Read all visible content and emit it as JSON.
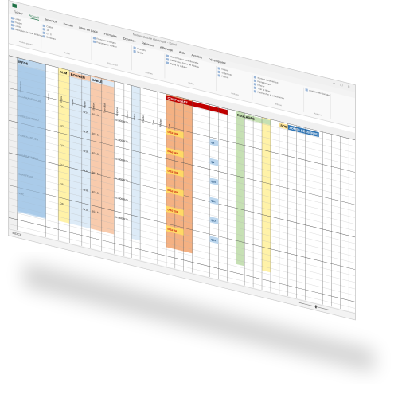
{
  "window": {
    "title": "Nomenclature électrique - Excel",
    "app_icon": "excel-icon",
    "tabs": [
      "Fichier",
      "Accueil",
      "Insertion",
      "Dessin",
      "Mise en page",
      "Formules",
      "Données",
      "Révision",
      "Affichage",
      "Aide",
      "Acrobat",
      "Développeur"
    ],
    "active_tab": "Accueil"
  },
  "ribbon": {
    "groups": [
      {
        "label": "Presse-papiers",
        "items": [
          "Coller",
          "Couper",
          "Copier",
          "Reproduire la mise en forme"
        ]
      },
      {
        "label": "Police",
        "items": [
          "Calibri",
          "11",
          "G I S",
          "Bordures"
        ]
      },
      {
        "label": "Alignement",
        "items": [
          "Renvoyer à la ligne",
          "Fusionner et centrer"
        ]
      },
      {
        "label": "Nombre",
        "items": [
          "Standard",
          "% 000"
        ]
      },
      {
        "label": "Styles",
        "items": [
          "Mise en forme conditionnelle",
          "Mettre sous forme de tableau",
          "Styles de cellules"
        ]
      },
      {
        "label": "Cellules",
        "items": [
          "Insérer",
          "Supprimer",
          "Format"
        ]
      },
      {
        "label": "Édition",
        "items": [
          "Somme automatique",
          "Remplissage",
          "Effacer",
          "Trier et filtrer",
          "Rechercher et sélectionner"
        ]
      },
      {
        "label": "Analyse",
        "items": [
          "Analyser les données"
        ]
      }
    ]
  },
  "sheet": {
    "sections": [
      {
        "label": "INFOS",
        "color": "#bdd7ee"
      },
      {
        "label": "ALIM",
        "color": "#fff2a8"
      },
      {
        "label": "BORNIER",
        "color": "#f8cbad"
      },
      {
        "label": "CABLE",
        "color": "#ddebf7"
      },
      {
        "label": "COMPOSANT",
        "color": "#f4b183"
      },
      {
        "label": "REGLAGES",
        "color": "#c6e0b4"
      },
      {
        "label": "SOS",
        "color": "#ffe699"
      },
      {
        "label": "ZONES DESSERTE",
        "color": "#2f75b5"
      }
    ],
    "column_headers": [
      "Désignation",
      "Divers",
      "Origine",
      "Départ",
      "Repère",
      "Section",
      "Type câble",
      "Longueur",
      "Appareil",
      "Calibre",
      "Courbe",
      "Type",
      "Réglage",
      "Zone"
    ],
    "rows": [
      {
        "designation": "ECLAIRAGE SALLE",
        "origine": "Q1",
        "repere": "W14",
        "section": "3G1.5",
        "cable": "U1000 R2V",
        "appareil": "DISJ 10A",
        "calibre": "Q8"
      },
      {
        "designation": "PRISES BUREAU",
        "origine": "Q2",
        "repere": "W15",
        "section": "3G2.5",
        "cable": "U1000 R2V",
        "appareil": "DISJ 16A",
        "calibre": "Q9"
      },
      {
        "designation": "PRISES ATELIER",
        "origine": "Q3",
        "repere": "W16",
        "section": "3G2.5",
        "cable": "U1000 R2V",
        "appareil": "DISJ 20A",
        "calibre": "Q10"
      },
      {
        "designation": "ECLAIRAGE EXT",
        "origine": "Q4",
        "repere": "W17",
        "section": "3G1.5",
        "cable": "U1000 R2V",
        "appareil": "DISJ 10A",
        "calibre": "Q11"
      },
      {
        "designation": "CHAUFFAGE",
        "origine": "Q5",
        "repere": "W18",
        "section": "3G2.5",
        "cable": "U1000 R2V",
        "appareil": "DISJ 20A",
        "calibre": "Q12"
      },
      {
        "designation": "VMC",
        "origine": "Q6",
        "repere": "W19",
        "section": "3G1.5",
        "cable": "U1000 R2V",
        "appareil": "DISJ 2A",
        "calibre": "Q13"
      }
    ],
    "sheet_tab": "INDICE",
    "zoom": "100 %"
  }
}
